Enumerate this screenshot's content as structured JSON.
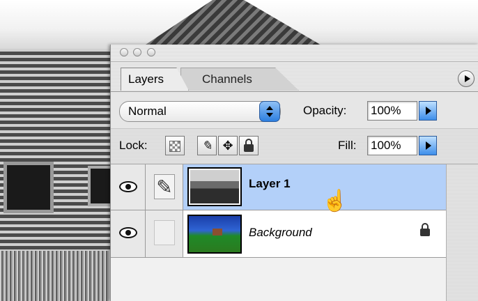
{
  "panel": {
    "tabs": [
      {
        "label": "Layers",
        "active": true
      },
      {
        "label": "Channels",
        "active": false
      }
    ],
    "blend_mode": "Normal",
    "opacity_label": "Opacity:",
    "opacity_value": "100%",
    "lock_label": "Lock:",
    "fill_label": "Fill:",
    "fill_value": "100%",
    "layers": [
      {
        "name": "Layer 1",
        "selected": true,
        "visible": true,
        "locked": false
      },
      {
        "name": "Background",
        "selected": false,
        "visible": true,
        "locked": true
      }
    ]
  },
  "colors": {
    "selection": "#b3d0f9",
    "aqua_blue": "#3e8eea"
  }
}
